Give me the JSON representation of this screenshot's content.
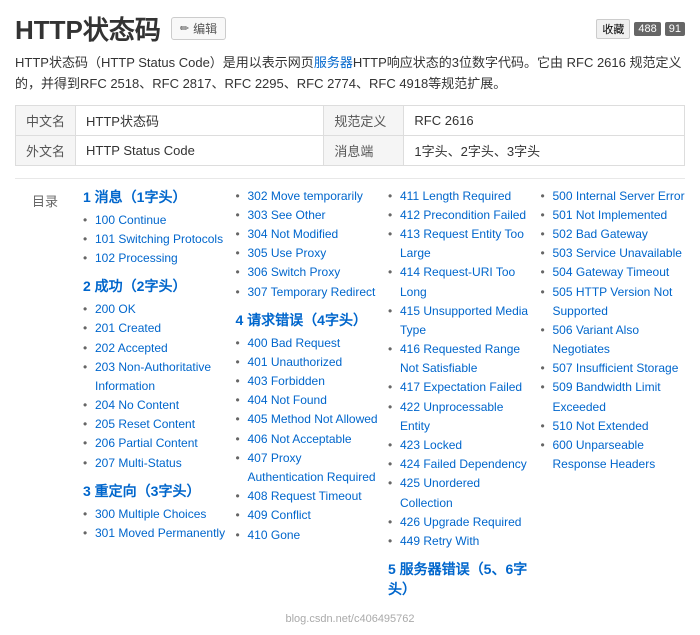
{
  "header": {
    "title": "HTTP状态码",
    "edit_label": "编辑",
    "top_actions": [
      "收藏",
      "488",
      "91"
    ]
  },
  "description": "HTTP状态码（HTTP Status Code）是用以表示网页服务器HTTP响应状态的3位数字代码。它由 RFC 2616 规范定义的，并得到RFC 2518、RFC 2817、RFC 2295、RFC 2774、RFC 4918等规范扩展。",
  "info_rows": [
    {
      "label1": "中文名",
      "value1": "HTTP状态码",
      "label2": "规范定义",
      "value2": "RFC 2616"
    },
    {
      "label1": "外文名",
      "value1": "HTTP Status Code",
      "label2": "消息端",
      "value2": "1字头、2字头、3字头"
    }
  ],
  "toc_label": "目录",
  "sections": {
    "col1": [
      {
        "heading": "1 消息（1字头）",
        "items": [
          "100 Continue",
          "101 Switching Protocols",
          "102 Processing"
        ]
      },
      {
        "heading": "2 成功（2字头）",
        "items": [
          "200 OK",
          "201 Created",
          "202 Accepted",
          "203 Non-Authoritative Information",
          "204 No Content",
          "205 Reset Content",
          "206 Partial Content",
          "207 Multi-Status"
        ]
      },
      {
        "heading": "3 重定向（3字头）",
        "items": [
          "300 Multiple Choices",
          "301 Moved Permanently"
        ]
      }
    ],
    "col2": [
      {
        "heading": "",
        "items": [
          "302 Move temporarily",
          "303 See Other",
          "304 Not Modified",
          "305 Use Proxy",
          "306 Switch Proxy",
          "307 Temporary Redirect"
        ]
      },
      {
        "heading": "4 请求错误（4字头）",
        "items": [
          "400 Bad Request",
          "401 Unauthorized",
          "403 Forbidden",
          "404 Not Found",
          "405 Method Not Allowed",
          "406 Not Acceptable",
          "407 Proxy Authentication Required",
          "408 Request Timeout",
          "409 Conflict",
          "410 Gone"
        ]
      }
    ],
    "col3": [
      {
        "heading": "",
        "items": [
          "411 Length Required",
          "412 Precondition Failed",
          "413 Request Entity Too Large",
          "414 Request-URI Too Long",
          "415 Unsupported Media Type",
          "416 Requested Range Not Satisfiable",
          "417 Expectation Failed",
          "422 Unprocessable Entity",
          "423 Locked",
          "424 Failed Dependency",
          "425 Unordered Collection",
          "426 Upgrade Required",
          "449 Retry With"
        ]
      },
      {
        "heading": "5 服务器错误（5、6字头）",
        "items": []
      }
    ],
    "col4": [
      {
        "heading": "",
        "items": [
          "500 Internal Server Error",
          "501 Not Implemented",
          "502 Bad Gateway",
          "503 Service Unavailable",
          "504 Gateway Timeout",
          "505 HTTP Version Not Supported",
          "506 Variant Also Negotiates",
          "507 Insufficient Storage",
          "509 Bandwidth Limit Exceeded",
          "510 Not Extended",
          "600 Unparseable Response Headers"
        ]
      }
    ]
  },
  "watermark": "blog.csdn.net/c406495762"
}
